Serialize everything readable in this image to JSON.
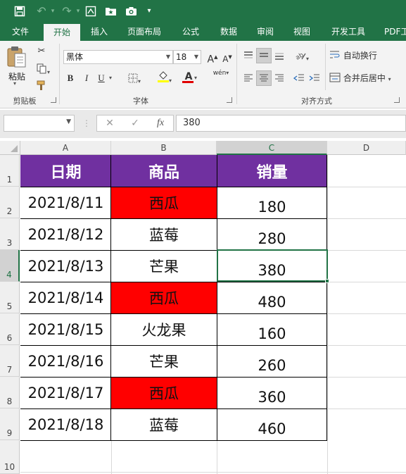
{
  "qat": {
    "save_icon": "save-icon",
    "undo_icon": "undo-icon",
    "redo_icon": "redo-icon",
    "glyph_more": "▾"
  },
  "tabs": [
    "文件",
    "开始",
    "插入",
    "页面布局",
    "公式",
    "数据",
    "审阅",
    "视图",
    "开发工具",
    "PDF工"
  ],
  "active_tab": "开始",
  "ribbon": {
    "clipboard": {
      "paste_label": "粘贴",
      "group_label": "剪贴板"
    },
    "font": {
      "font_name": "黑体",
      "font_size": "18",
      "bold": "B",
      "italic": "I",
      "underline": "U",
      "grow": "A",
      "shrink": "A",
      "font_color": "A",
      "phonetic": "wén",
      "group_label": "字体"
    },
    "alignment": {
      "wrap_text": "自动换行",
      "merge_center": "合并后居中",
      "group_label": "对齐方式"
    }
  },
  "formula_bar": {
    "name_box": "",
    "cancel": "✕",
    "enter": "✓",
    "fx": "fx",
    "value": "380"
  },
  "columns": [
    "A",
    "B",
    "C",
    "D"
  ],
  "selected_column": "C",
  "rows": [
    "1",
    "2",
    "3",
    "4",
    "5",
    "6",
    "7",
    "8",
    "9",
    "10"
  ],
  "selected_row": "4",
  "table": {
    "headers": [
      "日期",
      "商品",
      "销量"
    ],
    "rows": [
      {
        "date": "2021/8/11",
        "product": "西瓜",
        "sales": "180"
      },
      {
        "date": "2021/8/12",
        "product": "蓝莓",
        "sales": "280"
      },
      {
        "date": "2021/8/13",
        "product": "芒果",
        "sales": "380"
      },
      {
        "date": "2021/8/14",
        "product": "西瓜",
        "sales": "480"
      },
      {
        "date": "2021/8/15",
        "product": "火龙果",
        "sales": "160"
      },
      {
        "date": "2021/8/16",
        "product": "芒果",
        "sales": "260"
      },
      {
        "date": "2021/8/17",
        "product": "西瓜",
        "sales": "360"
      },
      {
        "date": "2021/8/18",
        "product": "蓝莓",
        "sales": "460"
      }
    ]
  },
  "colors": {
    "excel_green": "#217346",
    "header_fill": "#7030a0",
    "highlight_fill": "#ff0000",
    "fill_color_bar": "#ffff00",
    "font_color_bar": "#e00000"
  }
}
